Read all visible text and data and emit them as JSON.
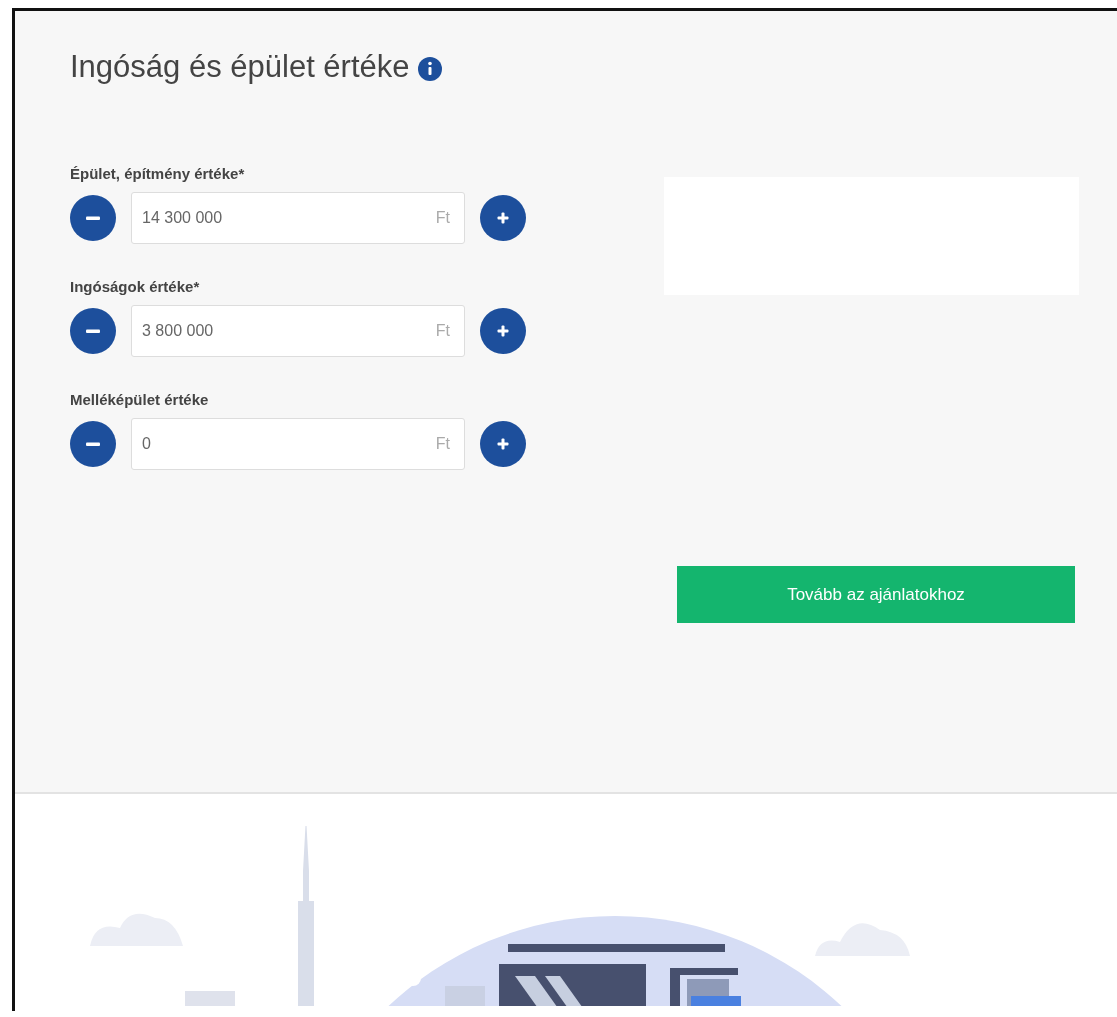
{
  "title": "Ingóság és épület értéke",
  "fields": [
    {
      "label": "Épület, építmény értéke*",
      "value": "14 300 000",
      "unit": "Ft"
    },
    {
      "label": "Ingóságok értéke*",
      "value": "3 800 000",
      "unit": "Ft"
    },
    {
      "label": "Melléképület értéke",
      "value": "0",
      "unit": "Ft"
    }
  ],
  "submit_button": "Tovább az ajánlatokhoz"
}
